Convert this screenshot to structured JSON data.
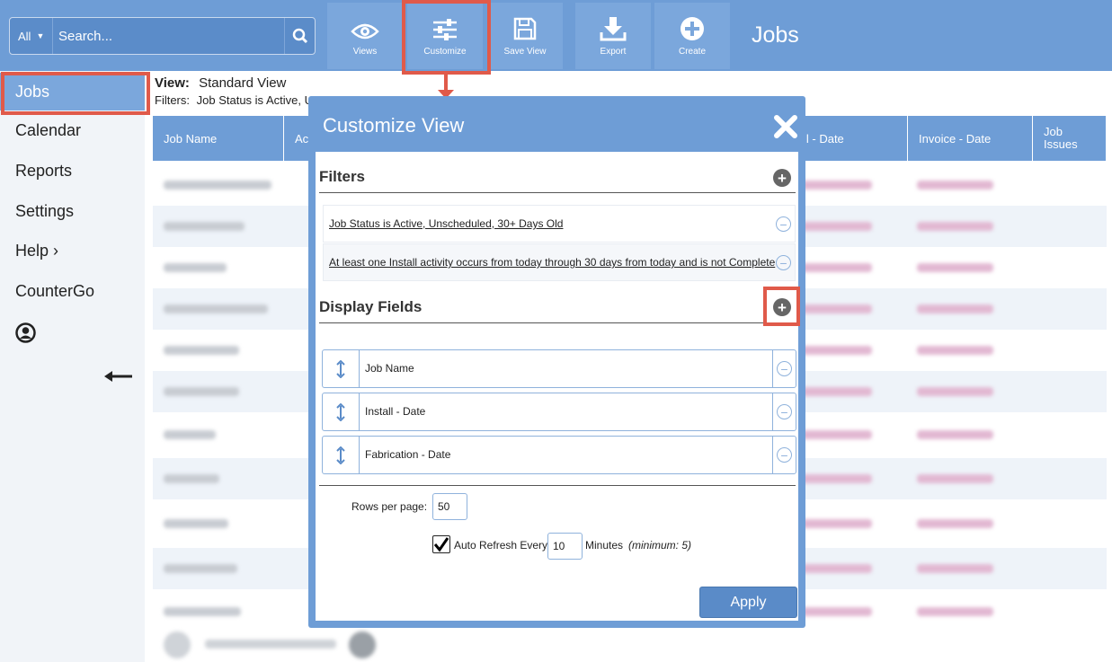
{
  "toolbar": {
    "scope_label": "All",
    "search_placeholder": "Search...",
    "buttons": [
      {
        "label": "Views",
        "icon": "eye-icon"
      },
      {
        "label": "Customize",
        "icon": "sliders-icon"
      },
      {
        "label": "Save View",
        "icon": "floppy-disk-icon"
      },
      {
        "label": "Export",
        "icon": "download-icon"
      },
      {
        "label": "Create",
        "icon": "plus-circle-icon"
      }
    ],
    "page_title": "Jobs"
  },
  "sidebar": {
    "items": [
      {
        "label": "Jobs",
        "active": true
      },
      {
        "label": "Calendar"
      },
      {
        "label": "Reports"
      },
      {
        "label": "Settings"
      },
      {
        "label": "Help ›"
      },
      {
        "label": "CounterGo"
      }
    ]
  },
  "content": {
    "view_label": "View:",
    "view_value": "Standard View",
    "filters_label": "Filters:",
    "filters_value": "Job Status is Active, U",
    "columns": [
      "Job Name",
      "Ac",
      "ll - Date",
      "Invoice - Date",
      "Job Issues"
    ]
  },
  "modal": {
    "title": "Customize View",
    "filters_title": "Filters",
    "filters": [
      "Job Status is Active, Unscheduled, 30+ Days Old",
      "At least one Install activity occurs from today through 30 days from today and is not Complete"
    ],
    "display_fields_title": "Display Fields",
    "display_fields": [
      "Job Name",
      "Install - Date",
      "Fabrication - Date"
    ],
    "rows_per_page_label": "Rows per page:",
    "rows_per_page_value": "50",
    "auto_refresh_label": "Auto Refresh Every",
    "auto_refresh_value": "10",
    "minutes_label": "Minutes",
    "minimum_note": "(minimum: 5)",
    "auto_refresh_checked": true,
    "apply_label": "Apply"
  },
  "colors": {
    "toolbar_bg": "#6e9dd6",
    "highlight": "#e05a4a",
    "apply_button": "#5a8bc8"
  }
}
